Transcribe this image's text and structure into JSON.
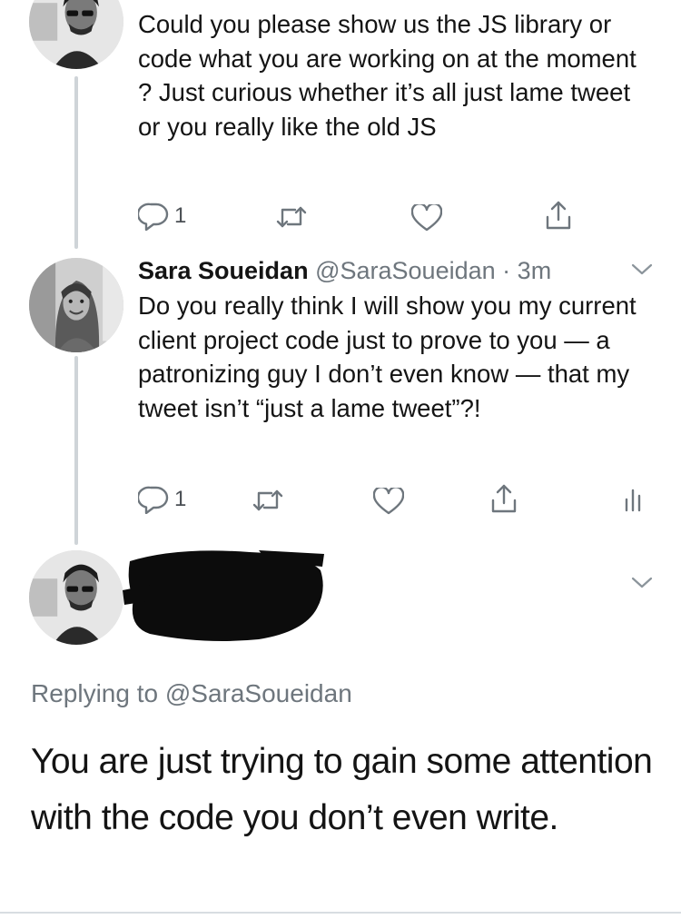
{
  "tweets": [
    {
      "body": "Could you please show us the JS library or code what you are working on at the moment ? Just curious whether it’s all just lame tweet or you really like the old JS",
      "actions": {
        "reply_count": "1",
        "retweet_count": "",
        "like_count": ""
      }
    },
    {
      "author": {
        "name": "Sara Soueidan",
        "handle": "@SaraSoueidan",
        "separator": "·",
        "time": "3m"
      },
      "body": "Do you really think I will show you my current client project code just to prove to you — a patronizing guy I don’t even know — that my tweet isn’t “just a lame tweet”?!",
      "actions": {
        "reply_count": "1",
        "retweet_count": "",
        "like_count": ""
      }
    }
  ],
  "reply": {
    "replying_to": "Replying to @SaraSoueidan",
    "body": "You are just trying to gain some attention with the code you don’t even write."
  },
  "colors": {
    "text": "#141414",
    "muted": "#6e767d",
    "thread_line": "#cfd4d8"
  },
  "icons": [
    "reply-icon",
    "retweet-icon",
    "like-icon",
    "share-icon",
    "analytics-icon",
    "chevron-down-icon"
  ]
}
